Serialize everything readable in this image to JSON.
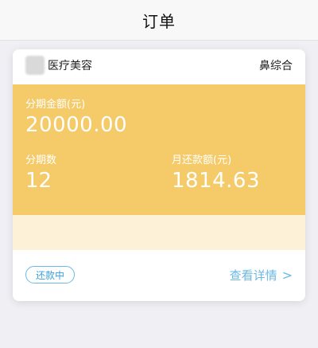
{
  "nav": {
    "title": "订单"
  },
  "order_card": {
    "merchant_name": "医疗美容",
    "procedure_name": "鼻综合",
    "installment_amount_label": "分期金额(元)",
    "installment_amount_value": "20000.00",
    "period_count_label": "分期数",
    "period_count_value": "12",
    "monthly_repayment_label": "月还款额(元)",
    "monthly_repayment_value": "1814.63",
    "status_badge": "还款中",
    "details_link": "查看详情",
    "details_icon": "chevron-right-icon",
    "colors": {
      "panel": "#f5cb69",
      "accent": "#6bb8e4"
    }
  }
}
